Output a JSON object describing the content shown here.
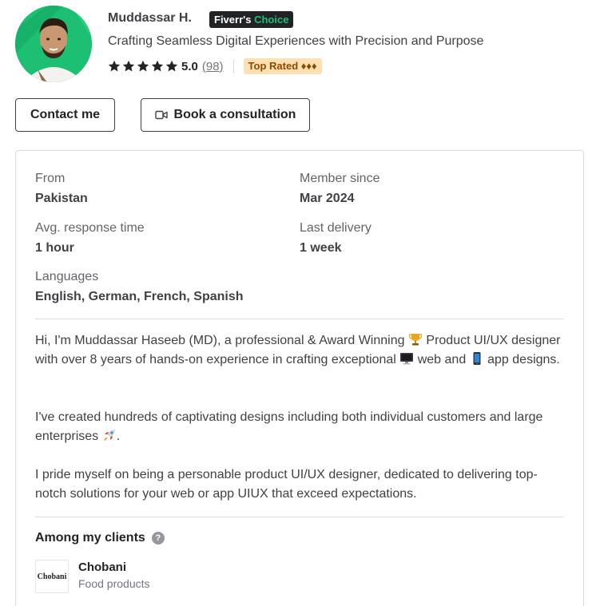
{
  "profile": {
    "name": "Muddassar H.",
    "badge_word1": "Fiverr's",
    "badge_word2": "Choice",
    "tagline": "Crafting Seamless Digital Experiences with Precision and Purpose",
    "rating_score": "5.0",
    "rating_count": "(98)",
    "stars": 5,
    "top_rated": "Top Rated ♦♦♦"
  },
  "actions": {
    "contact_label": "Contact me",
    "book_label": "Book a consultation"
  },
  "info": {
    "from_label": "From",
    "from_value": "Pakistan",
    "member_label": "Member since",
    "member_value": "Mar 2024",
    "response_label": "Avg. response time",
    "response_value": "1 hour",
    "delivery_label": "Last delivery",
    "delivery_value": "1 week",
    "languages_label": "Languages",
    "languages_value": "English, German, French, Spanish"
  },
  "description": {
    "p1_a": "Hi, I'm Muddassar Haseeb (MD), a professional & Award Winning",
    "p1_b": "Product UI/UX designer with over 8 years of hands-on experience in crafting exceptional",
    "p1_c": "web and",
    "p1_d": "app designs.",
    "p2_a": "I've created hundreds of captivating designs including both individual customers and large enterprises",
    "p2_b": ".",
    "p3": "I pride myself on being a personable product UI/UX designer, dedicated to delivering top-notch solutions for your web or app UIUX that exceed expectations."
  },
  "clients": {
    "title": "Among my clients",
    "help": "?",
    "items": [
      {
        "logo_text": "Chobani",
        "name": "Chobani",
        "category": "Food products"
      }
    ]
  },
  "colors": {
    "brand_green": "#1dbf73",
    "star": "#222325",
    "top_rated_bg": "#ffe0b3"
  }
}
